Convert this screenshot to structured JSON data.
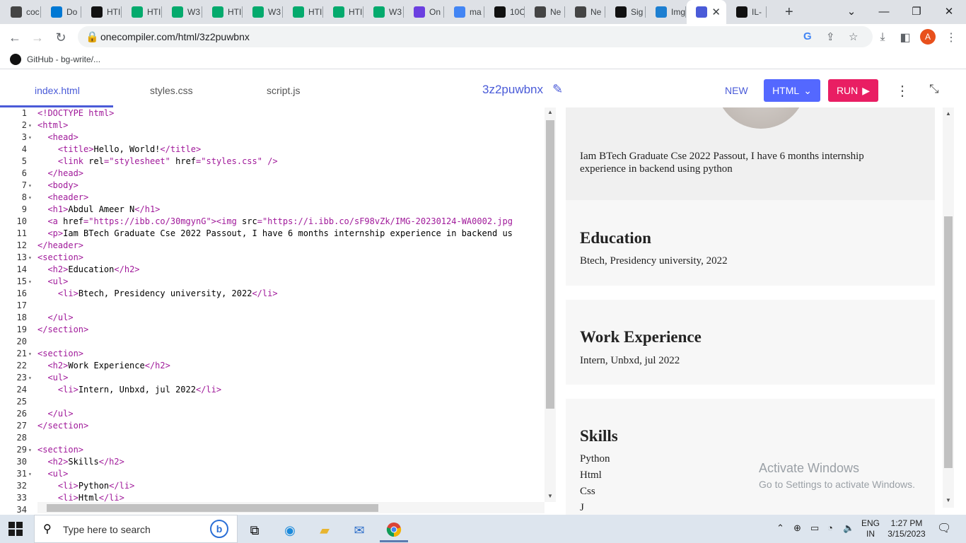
{
  "browser": {
    "tabs": [
      {
        "label": "coc",
        "icon": "onecompiler-icon",
        "color": "#444"
      },
      {
        "label": "Do",
        "icon": "vscode-icon",
        "color": "#0078d4"
      },
      {
        "label": "HTI",
        "icon": "codepen-icon",
        "color": "#111"
      },
      {
        "label": "HTI",
        "icon": "w3schools-icon",
        "color": "#04aa6d"
      },
      {
        "label": "W3",
        "icon": "w3schools-icon",
        "color": "#04aa6d"
      },
      {
        "label": "HTI",
        "icon": "w3schools-icon",
        "color": "#04aa6d"
      },
      {
        "label": "W3",
        "icon": "w3schools-icon",
        "color": "#04aa6d"
      },
      {
        "label": "HTI",
        "icon": "w3schools-icon",
        "color": "#04aa6d"
      },
      {
        "label": "HTI",
        "icon": "w3schools-icon",
        "color": "#04aa6d"
      },
      {
        "label": "W3",
        "icon": "w3schools-icon",
        "color": "#04aa6d"
      },
      {
        "label": "On",
        "icon": "pandora-icon",
        "color": "#6b3fe0"
      },
      {
        "label": "ma",
        "icon": "google-icon",
        "color": "#4285f4"
      },
      {
        "label": "10C",
        "icon": "hundred-icon",
        "color": "#111"
      },
      {
        "label": "Ne",
        "icon": "onecompiler-icon",
        "color": "#444"
      },
      {
        "label": "Ne",
        "icon": "onecompiler-icon",
        "color": "#444"
      },
      {
        "label": "Sig",
        "icon": "github-icon",
        "color": "#111"
      },
      {
        "label": "Img",
        "icon": "imgbb-icon",
        "color": "#1d7fd1"
      },
      {
        "label": "",
        "icon": "onecompiler-code-icon",
        "color": "#4a5bd8",
        "active": true
      },
      {
        "label": "IL-",
        "icon": "github-icon",
        "color": "#111"
      }
    ],
    "url": "onecompiler.com/html/3z2puwbnx",
    "bookmark": "GitHub - bg-write/...",
    "profile_initial": "A",
    "accent": "#4a5bd8"
  },
  "editor": {
    "file_tabs": [
      "index.html",
      "styles.css",
      "script.js"
    ],
    "active_file": "index.html",
    "project_name": "3z2puwbnx",
    "new_label": "NEW",
    "language_label": "HTML",
    "run_label": "RUN",
    "html_btn_color": "#5468ff",
    "run_btn_color": "#e91e63",
    "lines": [
      {
        "n": "1",
        "fold": "",
        "t": "<!DOCTYPE html>"
      },
      {
        "n": "2",
        "fold": "▾",
        "t": "<html>"
      },
      {
        "n": "3",
        "fold": "▾",
        "t": "  <head>"
      },
      {
        "n": "4",
        "fold": "",
        "t": "    <title>Hello, World!</title>"
      },
      {
        "n": "5",
        "fold": "",
        "t": "    <link rel=\"stylesheet\" href=\"styles.css\" />"
      },
      {
        "n": "6",
        "fold": "",
        "t": "  </head>"
      },
      {
        "n": "7",
        "fold": "▾",
        "t": "  <body>"
      },
      {
        "n": "8",
        "fold": "▾",
        "t": "  <header>"
      },
      {
        "n": "9",
        "fold": "",
        "t": "  <h1>Abdul Ameer N</h1>"
      },
      {
        "n": "10",
        "fold": "",
        "t": "  <a href=\"https://ibb.co/30mgynG\"><img src=\"https://i.ibb.co/sF98vZk/IMG-20230124-WA0002.jpg"
      },
      {
        "n": "11",
        "fold": "",
        "t": "  <p>Iam BTech Graduate Cse 2022 Passout, I have 6 months internship experience in backend us"
      },
      {
        "n": "12",
        "fold": "",
        "t": "</header>"
      },
      {
        "n": "13",
        "fold": "▾",
        "t": "<section>"
      },
      {
        "n": "14",
        "fold": "",
        "t": "  <h2>Education</h2>"
      },
      {
        "n": "15",
        "fold": "▾",
        "t": "  <ul>"
      },
      {
        "n": "16",
        "fold": "",
        "t": "    <li>Btech, Presidency university, 2022</li>"
      },
      {
        "n": "17",
        "fold": "",
        "t": ""
      },
      {
        "n": "18",
        "fold": "",
        "t": "  </ul>"
      },
      {
        "n": "19",
        "fold": "",
        "t": "</section>"
      },
      {
        "n": "20",
        "fold": "",
        "t": ""
      },
      {
        "n": "21",
        "fold": "▾",
        "t": "<section>"
      },
      {
        "n": "22",
        "fold": "",
        "t": "  <h2>Work Experience</h2>"
      },
      {
        "n": "23",
        "fold": "▾",
        "t": "  <ul>"
      },
      {
        "n": "24",
        "fold": "",
        "t": "    <li>Intern, Unbxd, jul 2022</li>"
      },
      {
        "n": "25",
        "fold": "",
        "t": ""
      },
      {
        "n": "26",
        "fold": "",
        "t": "  </ul>"
      },
      {
        "n": "27",
        "fold": "",
        "t": "</section>"
      },
      {
        "n": "28",
        "fold": "",
        "t": ""
      },
      {
        "n": "29",
        "fold": "▾",
        "t": "<section>"
      },
      {
        "n": "30",
        "fold": "",
        "t": "  <h2>Skills</h2>"
      },
      {
        "n": "31",
        "fold": "▾",
        "t": "  <ul>"
      },
      {
        "n": "32",
        "fold": "",
        "t": "    <li>Python</li>"
      },
      {
        "n": "33",
        "fold": "",
        "t": "    <li>Html</li>"
      },
      {
        "n": "34",
        "fold": "",
        "t": ""
      }
    ]
  },
  "preview": {
    "about": "Iam BTech Graduate Cse 2022 Passout, I have 6 months internship experience in backend using python",
    "education": {
      "heading": "Education",
      "items": [
        "Btech, Presidency university, 2022"
      ]
    },
    "work": {
      "heading": "Work Experience",
      "items": [
        "Intern, Unbxd, jul 2022"
      ]
    },
    "skills": {
      "heading": "Skills",
      "items": [
        "Python",
        "Html",
        "Css",
        "J"
      ]
    },
    "watermark_title": "Activate Windows",
    "watermark_sub": "Go to Settings to activate Windows."
  },
  "taskbar": {
    "search_placeholder": "Type here to search",
    "lang_line1": "ENG",
    "lang_line2": "IN",
    "time": "1:27 PM",
    "date": "3/15/2023"
  }
}
